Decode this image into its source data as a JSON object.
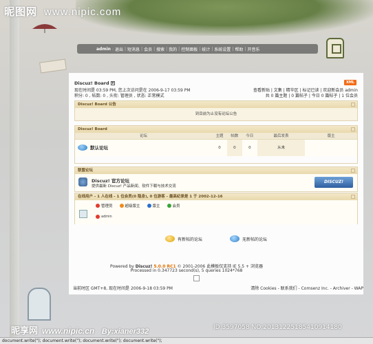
{
  "watermark_top": {
    "cn": "昵图网",
    "url": "www.nipic.com"
  },
  "watermark_bottom": {
    "cn": "昵享网",
    "url": "www.nipic.cn",
    "user": "By:xianer332",
    "id": "ID:3597058 NO:20131225185410914180"
  },
  "navbar": {
    "user": "admin",
    "items": [
      "退出",
      "短消息",
      "会员",
      "搜索",
      "我的",
      "控制面板",
      "统计",
      "系统设置",
      "帮助",
      "开音乐"
    ]
  },
  "header": {
    "board_title": "Discuz! Board",
    "xml_badge": "XML",
    "time_line": "现在时间是 03:59 PM, 您上次访问是在 2006-9-17 03:59 PM",
    "stats_line": "积分: 0 , 帖数: 0 , 头衔: 管理员 , 状态: 正常模式",
    "links_right": "查看新贴 | 文集 | 精华区 | 标记已读 | 欢迎新会员 admin",
    "counts_right": "共 0 篇主题 | 0 篇帖子 | 今日 0 篇帖子 | 1 位会员"
  },
  "announcement": {
    "title": "Discuz! Board 公告",
    "text": "到目前为止没有论坛公告"
  },
  "board": {
    "title": "Discuz! Board",
    "columns": [
      "论坛",
      "主题",
      "帖数",
      "今日",
      "最后发表",
      "版主"
    ],
    "rows": [
      {
        "name": "默认论坛",
        "topics": "0",
        "posts": "0",
        "today": "0",
        "last": "从未",
        "moderator": ""
      }
    ]
  },
  "league": {
    "title": "联盟论坛",
    "name": "Discuz! 官方论坛",
    "desc": "提供最新 Discuz! 产品新闻、软件下载与技术交流",
    "logo_text": "DISCUZ!"
  },
  "online": {
    "title": "在线用户",
    "summary": "- 1 人在线 - 1 位会员(0 隐身), 0 位游客 - 最高纪录是 1 于 2002-12-16",
    "legend": [
      {
        "label": "管理员",
        "color": "#e23b2e"
      },
      {
        "label": "超级版主",
        "color": "#f08a1c"
      },
      {
        "label": "版主",
        "color": "#2a6fd0"
      },
      {
        "label": "会员",
        "color": "#3aa43a"
      }
    ],
    "user": "admin"
  },
  "post_legend": {
    "new": "有新帖的论坛",
    "none": "无新帖的论坛"
  },
  "footer": {
    "powered": "Powered by",
    "product": "Discuz!",
    "version": "5.0.0 RC1",
    "copyright": "© 2001-2006",
    "browser_note": "此模板仅支持 IE 5.5 + 浏览器",
    "processed": "Processed in 0.347723 second(s), 5 queries 1024*768",
    "timezone": "当前时区 GMT+8, 现在时间是 2006-9-18 03:59 PM",
    "links": "清除 Cookies - 联系我们 - Comsenz Inc. - Archiver - WAP"
  },
  "statusbar": "document.write(\"); document.write(\"); document.write(\"); document.write(\");"
}
